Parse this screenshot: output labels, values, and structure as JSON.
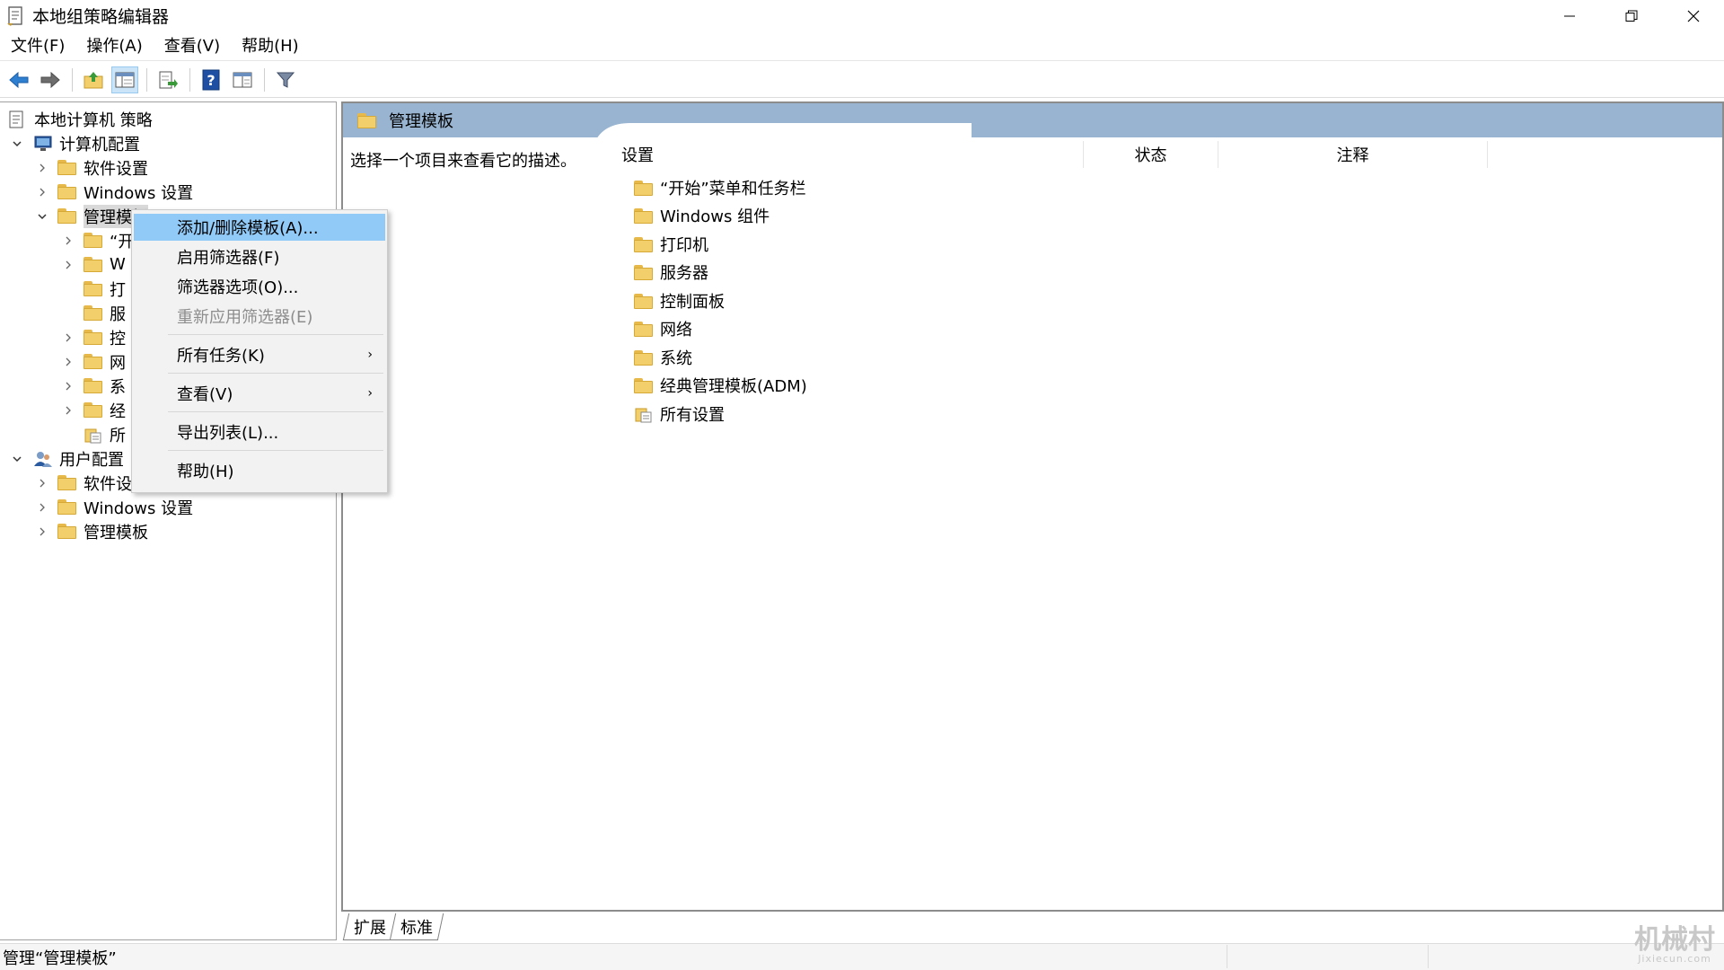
{
  "window": {
    "title": "本地组策略编辑器"
  },
  "menubar": {
    "items": [
      "文件(F)",
      "操作(A)",
      "查看(V)",
      "帮助(H)"
    ]
  },
  "toolbar": {
    "icons": [
      "back-arrow-icon",
      "forward-arrow-icon",
      "up-folder-icon",
      "show-hide-tree-icon",
      "export-list-icon",
      "help-icon",
      "properties-icon",
      "filter-icon"
    ]
  },
  "tree": {
    "root": "本地计算机 策略",
    "computer_config": "计算机配置",
    "cc_software": "软件设置",
    "cc_windows": "Windows 设置",
    "cc_admin": "管理模板",
    "cc_admin_children": [
      "“开",
      "W",
      "打",
      "服",
      "控",
      "网",
      "系",
      "经",
      "所"
    ],
    "user_config": "用户配置",
    "uc_software": "软件设",
    "uc_windows": "Windows 设置",
    "uc_admin": "管理模板"
  },
  "right_pane": {
    "header": "管理模板",
    "description": "选择一个项目来查看它的描述。",
    "columns": [
      "设置",
      "状态",
      "注释"
    ],
    "items": [
      "“开始”菜单和任务栏",
      "Windows 组件",
      "打印机",
      "服务器",
      "控制面板",
      "网络",
      "系统",
      "经典管理模板(ADM)",
      "所有设置"
    ],
    "tabs": [
      "扩展",
      "标准"
    ]
  },
  "context_menu": {
    "items": [
      {
        "label": "添加/删除模板(A)...",
        "state": "highlighted"
      },
      {
        "label": "启用筛选器(F)",
        "state": "normal"
      },
      {
        "label": "筛选器选项(O)...",
        "state": "normal"
      },
      {
        "label": "重新应用筛选器(E)",
        "state": "disabled"
      },
      {
        "label": "所有任务(K)",
        "state": "submenu"
      },
      {
        "label": "查看(V)",
        "state": "submenu"
      },
      {
        "label": "导出列表(L)...",
        "state": "normal"
      },
      {
        "label": "帮助(H)",
        "state": "normal"
      }
    ]
  },
  "statusbar": {
    "text": "管理“管理模板”"
  },
  "watermark": {
    "main": "机械村",
    "sub": "Jixiecun.com"
  },
  "colors": {
    "header_bg": "#98b4d0",
    "menu_highlight": "#91c9f7",
    "folder": "#f3cf6b"
  }
}
